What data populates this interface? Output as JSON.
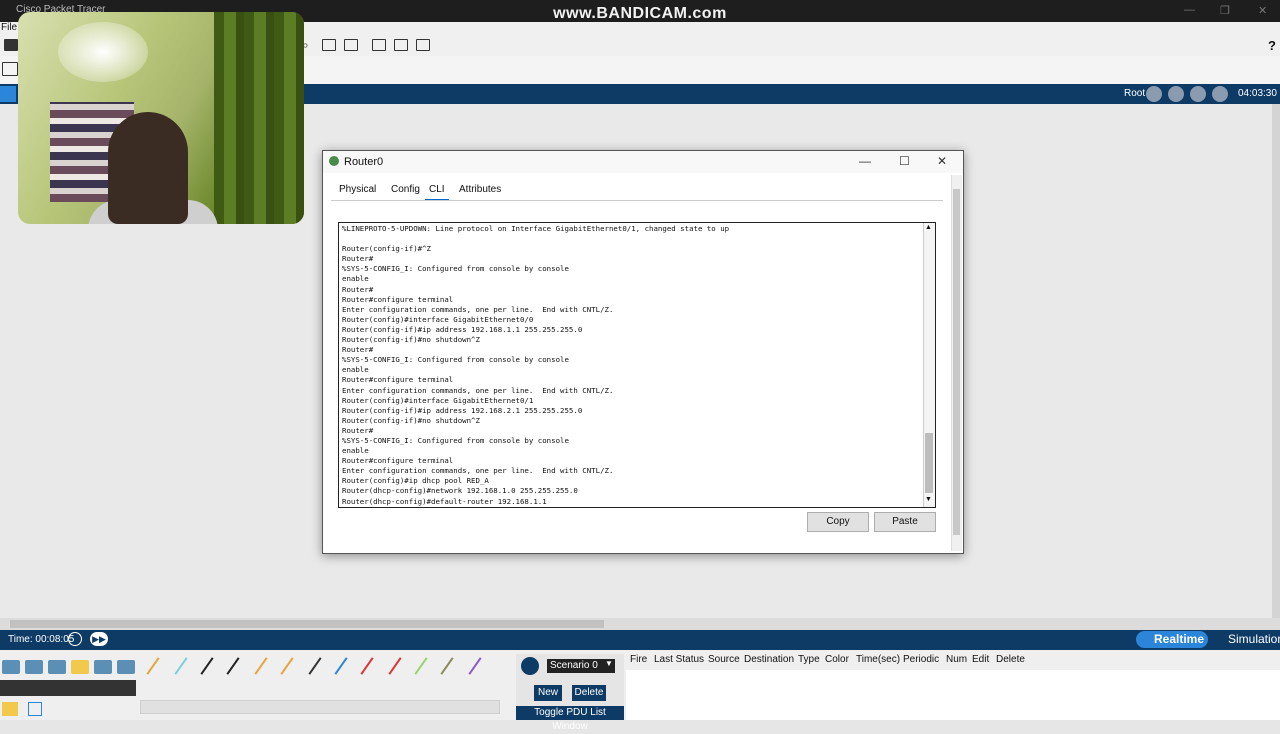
{
  "app": {
    "title": "Cisco Packet Tracer",
    "watermark": "www.BANDICAM.com"
  },
  "menu": {
    "file": "File"
  },
  "toolbar": {
    "help": "?"
  },
  "logical_bar": {
    "root": "Root",
    "clock": "04:03:30"
  },
  "router_window": {
    "title": "Router0",
    "tabs": [
      "Physical",
      "Config",
      "CLI",
      "Attributes"
    ],
    "active_tab": "CLI",
    "terminal_lines": [
      "%LINEPROTO-5-UPDOWN: Line protocol on Interface GigabitEthernet0/1, changed state to up",
      "",
      "Router(config-if)#^Z",
      "Router#",
      "%SYS-5-CONFIG_I: Configured from console by console",
      "enable",
      "Router#",
      "Router#configure terminal",
      "Enter configuration commands, one per line.  End with CNTL/Z.",
      "Router(config)#interface GigabitEthernet0/0",
      "Router(config-if)#ip address 192.168.1.1 255.255.255.0",
      "Router(config-if)#no shutdown^Z",
      "Router#",
      "%SYS-5-CONFIG_I: Configured from console by console",
      "enable",
      "Router#configure terminal",
      "Enter configuration commands, one per line.  End with CNTL/Z.",
      "Router(config)#interface GigabitEthernet0/1",
      "Router(config-if)#ip address 192.168.2.1 255.255.255.0",
      "Router(config-if)#no shutdown^Z",
      "Router#",
      "%SYS-5-CONFIG_I: Configured from console by console",
      "enable",
      "Router#configure terminal",
      "Enter configuration commands, one per line.  End with CNTL/Z.",
      "Router(config)#ip dhcp pool RED_A",
      "Router(dhcp-config)#network 192.168.1.0 255.255.255.0",
      "Router(dhcp-config)#default-router 192.168.1.1"
    ],
    "copy_label": "Copy",
    "paste_label": "Paste"
  },
  "statusbar": {
    "time": "Time: 00:08:05",
    "realtime": "Realtime",
    "simulation": "Simulation"
  },
  "scenario": {
    "selected": "Scenario 0",
    "new": "New",
    "delete": "Delete",
    "toggle": "Toggle PDU List Window"
  },
  "pdu_columns": [
    "Fire",
    "Last Status",
    "Source",
    "Destination",
    "Type",
    "Color",
    "Time(sec)",
    "Periodic",
    "Num",
    "Edit",
    "Delete"
  ],
  "colors": {
    "navy": "#0d3b66",
    "realtime_blue": "#2b86d9"
  }
}
